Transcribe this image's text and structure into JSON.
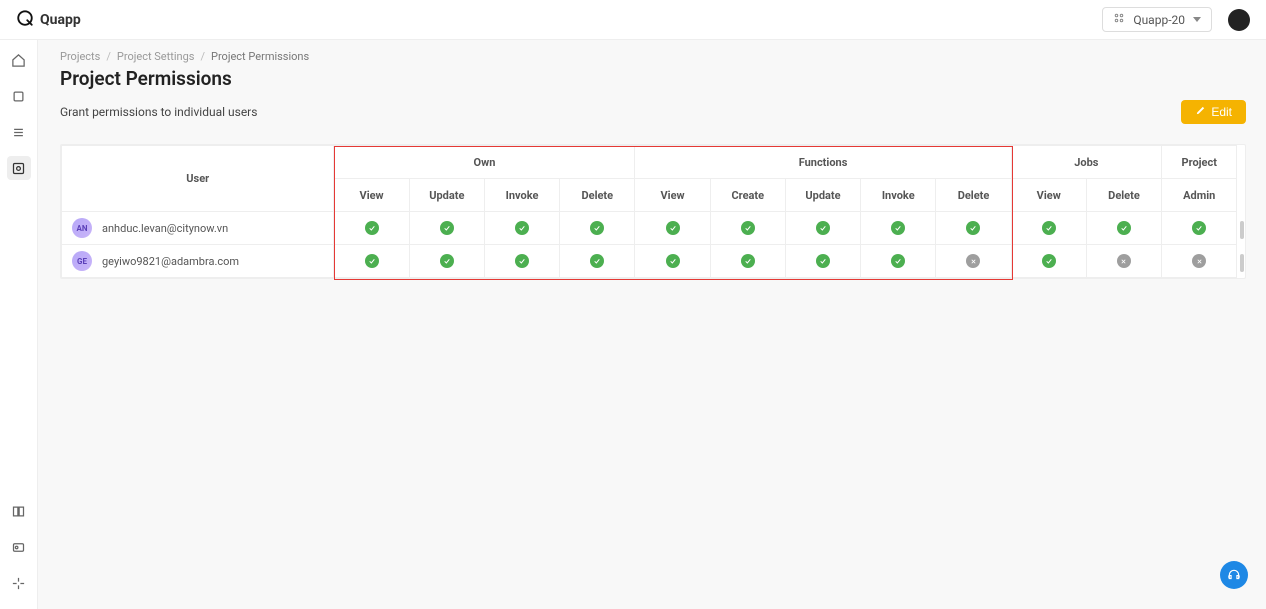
{
  "brand": {
    "name": "Quapp"
  },
  "workspace": {
    "label": "Quapp-20"
  },
  "breadcrumb": {
    "a": "Projects",
    "b": "Project Settings",
    "c": "Project Permissions"
  },
  "page": {
    "title": "Project Permissions",
    "subtitle": "Grant permissions to individual users"
  },
  "buttons": {
    "edit": "Edit"
  },
  "table": {
    "user_header": "User",
    "groups": [
      {
        "name": "Own",
        "cols": [
          "View",
          "Update",
          "Invoke",
          "Delete"
        ]
      },
      {
        "name": "Functions",
        "cols": [
          "View",
          "Create",
          "Update",
          "Invoke",
          "Delete"
        ]
      },
      {
        "name": "Jobs",
        "cols": [
          "View",
          "Delete"
        ]
      },
      {
        "name": "Project",
        "cols": [
          "Admin"
        ]
      }
    ],
    "rows": [
      {
        "initials": "AN",
        "email": "anhduc.levan@citynow.vn",
        "perms": [
          true,
          true,
          true,
          true,
          true,
          true,
          true,
          true,
          true,
          true,
          true,
          true
        ]
      },
      {
        "initials": "GE",
        "email": "geyiwo9821@adambra.com",
        "perms": [
          true,
          true,
          true,
          true,
          true,
          true,
          true,
          true,
          false,
          true,
          false,
          false
        ]
      }
    ]
  }
}
